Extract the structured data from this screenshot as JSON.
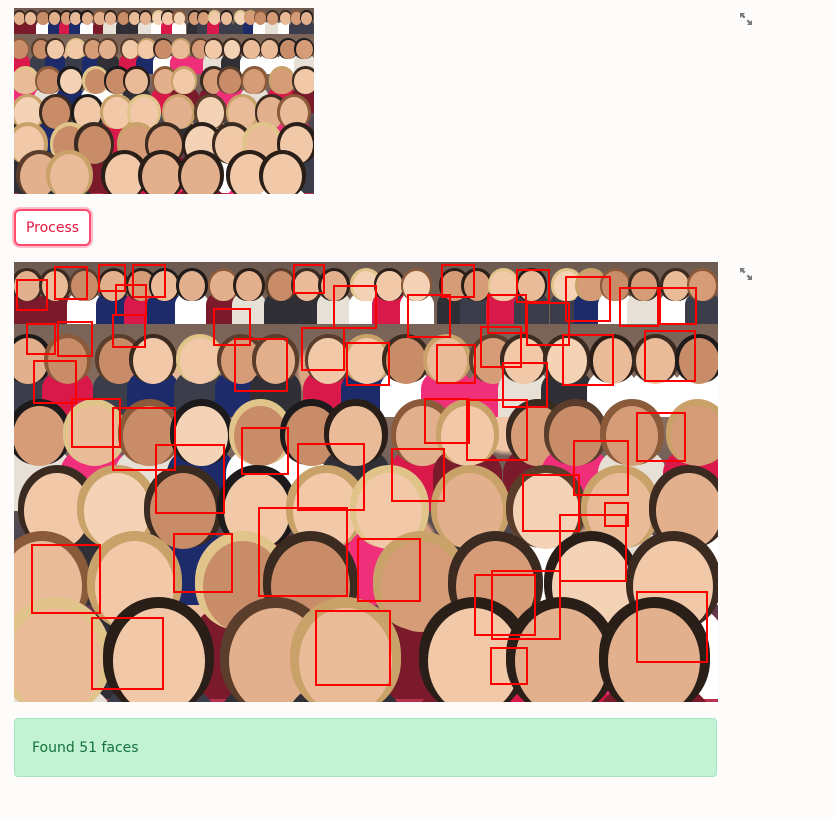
{
  "input_image": {
    "alt": "",
    "fullscreen_icon": "expand-icon"
  },
  "process_button": {
    "label": "Process"
  },
  "output_image": {
    "alt": "",
    "fullscreen_icon": "expand-icon",
    "box_color": "#ff0000",
    "faces_detected": 51
  },
  "status": {
    "message": "Found 51 faces",
    "background": "#c3f2d5",
    "text_color": "#13733a"
  },
  "accent_color": "#ff4b6e"
}
